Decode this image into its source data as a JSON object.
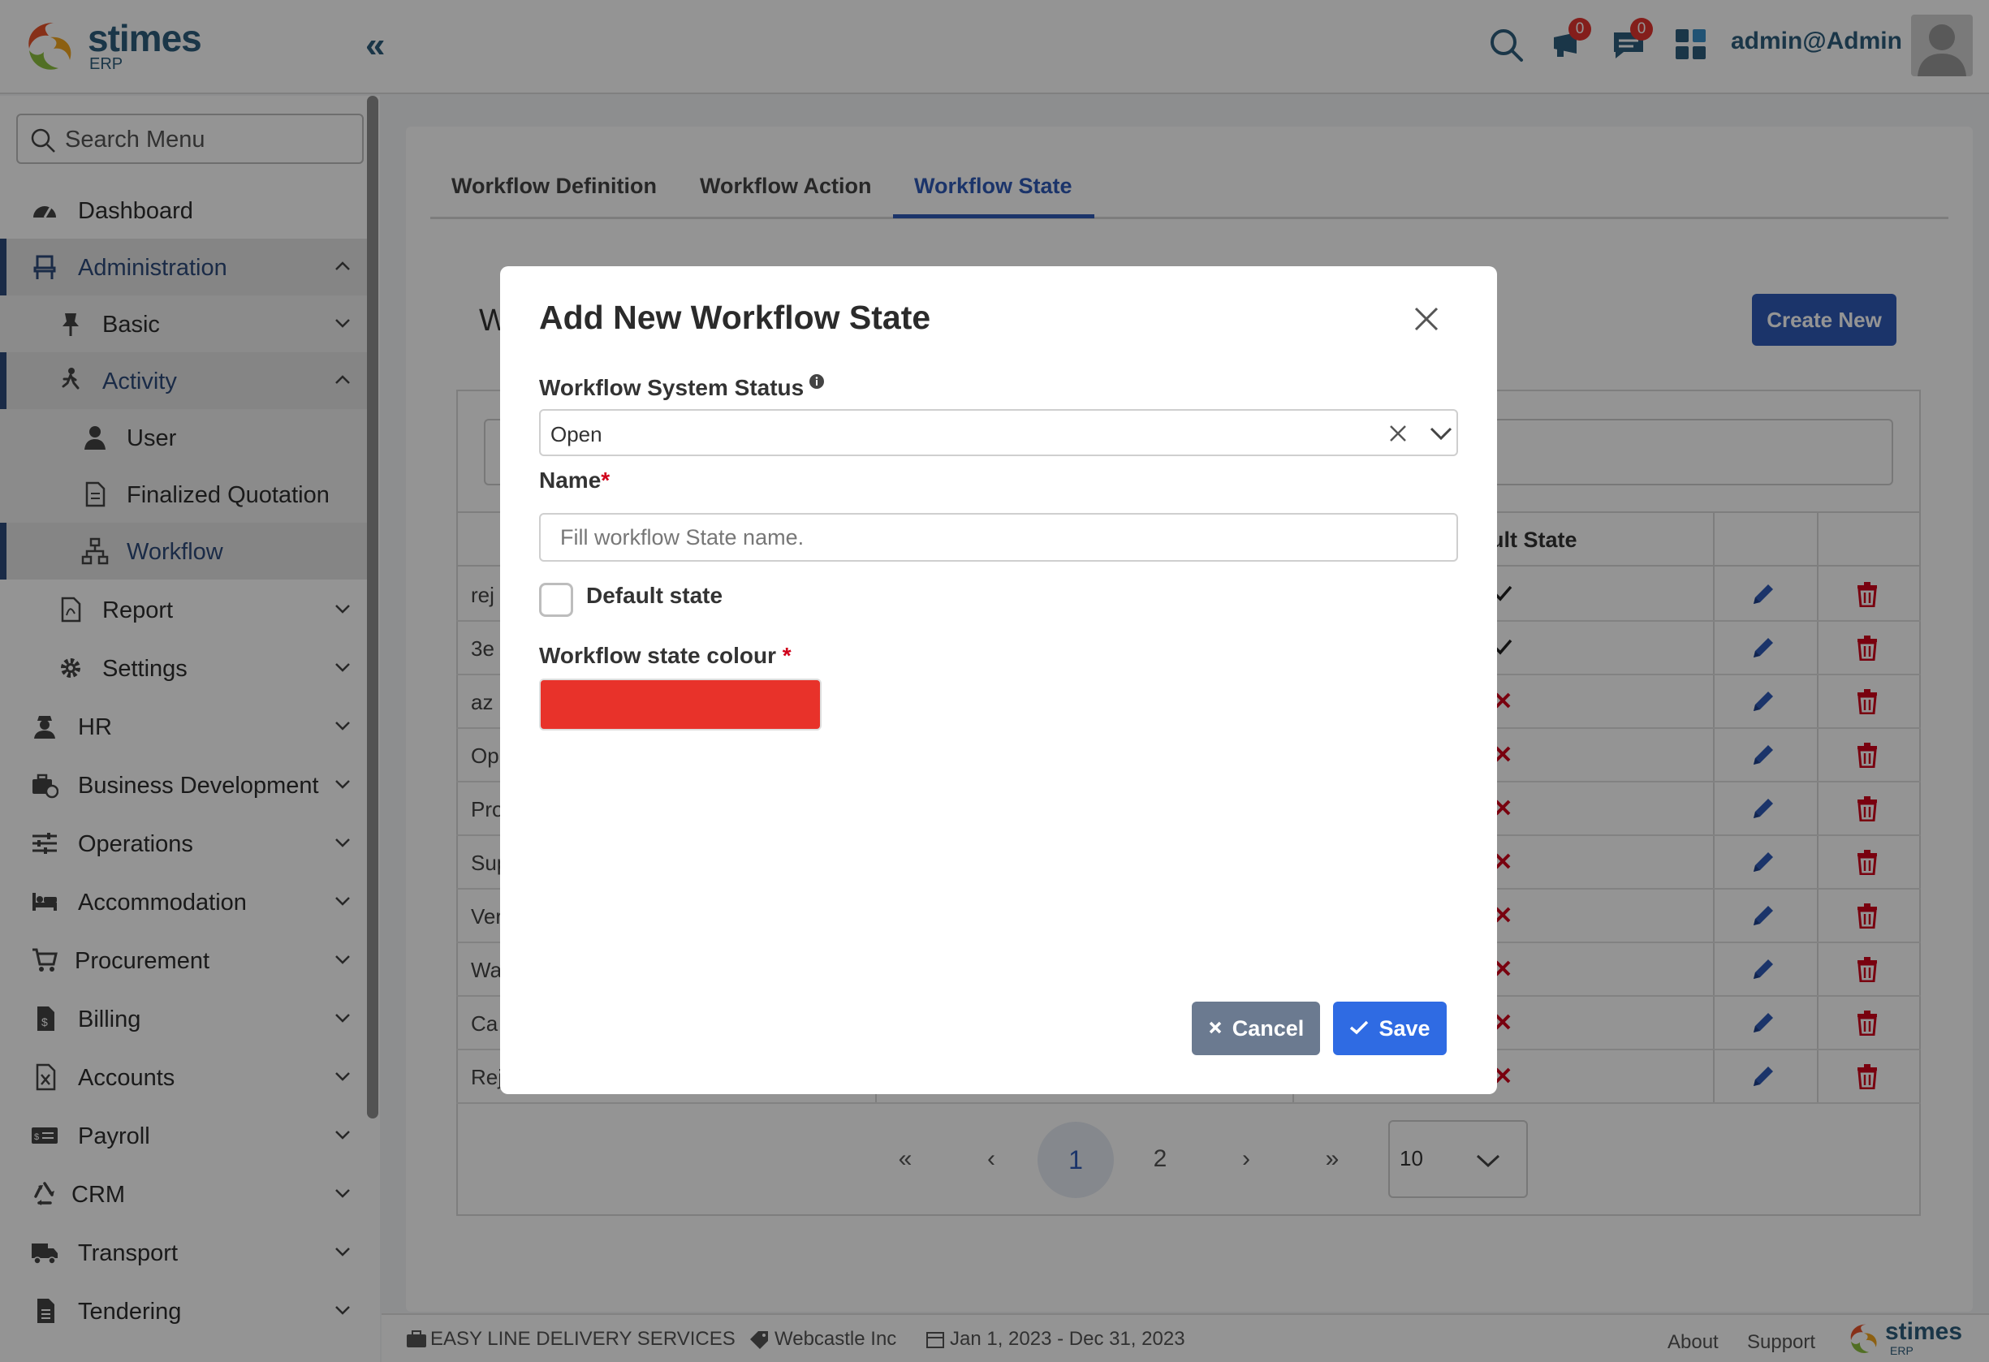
{
  "brand": {
    "name": "stimes",
    "sub": "ERP"
  },
  "header": {
    "user": "admin@Admin",
    "notifications_count": "0",
    "messages_count": "0"
  },
  "sidebar": {
    "search_placeholder": "Search Menu",
    "items": {
      "dashboard": "Dashboard",
      "administration": "Administration",
      "basic": "Basic",
      "activity": "Activity",
      "user": "User",
      "finalized_quotation": "Finalized Quotation",
      "workflow": "Workflow",
      "report": "Report",
      "settings": "Settings",
      "hr": "HR",
      "business_development": "Business Development",
      "operations": "Operations",
      "accommodation": "Accommodation",
      "procurement": "Procurement",
      "billing": "Billing",
      "accounts": "Accounts",
      "payroll": "Payroll",
      "crm": "CRM",
      "transport": "Transport",
      "tendering": "Tendering"
    }
  },
  "main": {
    "tabs": [
      "Workflow Definition",
      "Workflow Action",
      "Workflow State"
    ],
    "active_tab": "Workflow State",
    "title_fragment": "W",
    "create_button": "Create New",
    "column_fragment": "ult State",
    "rows": [
      {
        "frag": "rej",
        "default": true
      },
      {
        "frag": "3e",
        "default": true
      },
      {
        "frag": "az",
        "default": false
      },
      {
        "frag": "Op",
        "default": false
      },
      {
        "frag": "Pro",
        "default": false
      },
      {
        "frag": "Sup",
        "default": false
      },
      {
        "frag": "Ver",
        "default": false
      },
      {
        "frag": "Wa",
        "default": false
      },
      {
        "frag": "Ca",
        "default": false
      },
      {
        "frag": "Rej",
        "default": false
      }
    ],
    "pagination": {
      "first": "«",
      "prev": "‹",
      "pages": [
        "1",
        "2"
      ],
      "current": "1",
      "next": "›",
      "last": "»",
      "per_page": "10"
    }
  },
  "footer": {
    "company": "EASY LINE DELIVERY SERVICES",
    "branch": "Webcastle Inc",
    "period": "Jan 1, 2023 - Dec 31, 2023",
    "about": "About",
    "support": "Support"
  },
  "modal": {
    "title": "Add New Workflow State",
    "status_label": "Workflow System Status",
    "status_value": "Open",
    "name_label": "Name",
    "name_placeholder": "Fill workflow State name.",
    "default_label": "Default state",
    "default_checked": false,
    "colour_label": "Workflow state colour",
    "colour_value": "#e8322a",
    "cancel_label": "Cancel",
    "save_label": "Save"
  },
  "colors": {
    "primary": "#2f5bb7",
    "sidebar_accent": "#2e4a7a",
    "danger": "#d0021b",
    "cancel": "#6b7a90",
    "save": "#2f6be3"
  }
}
